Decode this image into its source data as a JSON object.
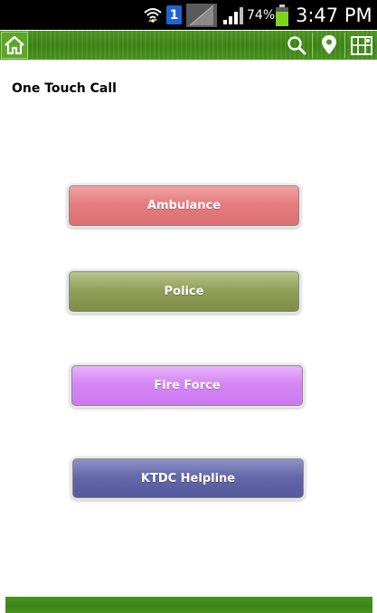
{
  "status_bar": {
    "battery_percent": "74%",
    "time": "3:47 PM",
    "sim_label": "1",
    "icons": [
      "wifi-icon",
      "sim-1-icon",
      "signal-icon",
      "battery-icon"
    ]
  },
  "toolbar": {
    "home_icon": "home-icon",
    "search_icon": "search-icon",
    "location_icon": "location-pin-icon",
    "map_icon": "map-icon"
  },
  "page": {
    "title": "One Touch Call"
  },
  "buttons": {
    "ambulance": "Ambulance",
    "police": "Police",
    "fire_force": "Fire Force",
    "ktdc_helpline": "KTDC Helpline"
  },
  "colors": {
    "header_green": "#3f8616",
    "ambulance": "#e47d80",
    "police": "#93a05a",
    "fire_force": "#d486f5",
    "ktdc_helpline": "#6568a9"
  }
}
